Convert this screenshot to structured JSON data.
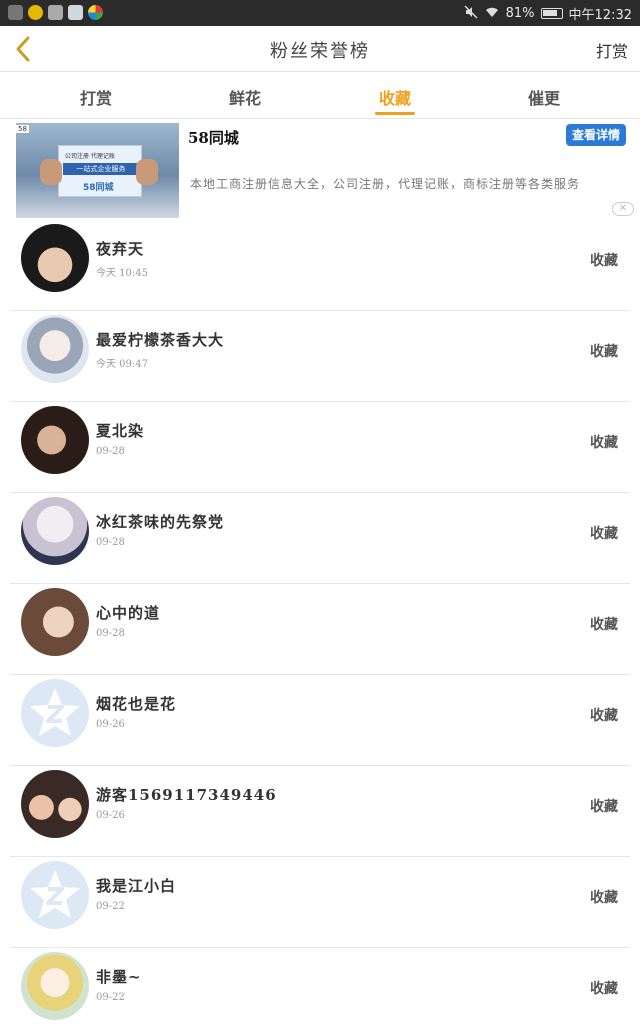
{
  "status_bar": {
    "battery": "81%",
    "time": "中午12:32"
  },
  "header": {
    "title": "粉丝荣誉榜",
    "right_link": "打赏"
  },
  "tabs": [
    {
      "label": "打赏"
    },
    {
      "label": "鲜花"
    },
    {
      "label": "收藏"
    },
    {
      "label": "催更"
    }
  ],
  "active_tab": "收藏",
  "ad": {
    "image_line1": "公司注册  代理记账",
    "image_line2": "一站式企业服务",
    "image_line3": "58同城",
    "image_badge": "58",
    "advertiser": "58同城",
    "description": "本地工商注册信息大全，公司注册，代理记账，商标注册等各类服务",
    "cta": "查看详情",
    "close": "✕"
  },
  "list": [
    {
      "name": "夜弃天",
      "time": "今天 10:45",
      "action": "收藏"
    },
    {
      "name": "最爱柠檬茶香大大",
      "time": "今天 09:47",
      "action": "收藏"
    },
    {
      "name": "夏北染",
      "time": "09-28",
      "action": "收藏"
    },
    {
      "name": "冰红茶味的先祭党",
      "time": "09-28",
      "action": "收藏"
    },
    {
      "name": "心中的道",
      "time": "09-28",
      "action": "收藏"
    },
    {
      "name": "烟花也是花",
      "time": "09-26",
      "action": "收藏"
    },
    {
      "name": "游客1569117349446",
      "time": "09-26",
      "action": "收藏"
    },
    {
      "name": "我是江小白",
      "time": "09-22",
      "action": "收藏"
    },
    {
      "name": "非墨~",
      "time": "09-22",
      "action": "收藏"
    }
  ],
  "colors": {
    "accent": "#f0a020",
    "cta": "#2b7bd6",
    "status_bar": "#2b2b2b"
  }
}
